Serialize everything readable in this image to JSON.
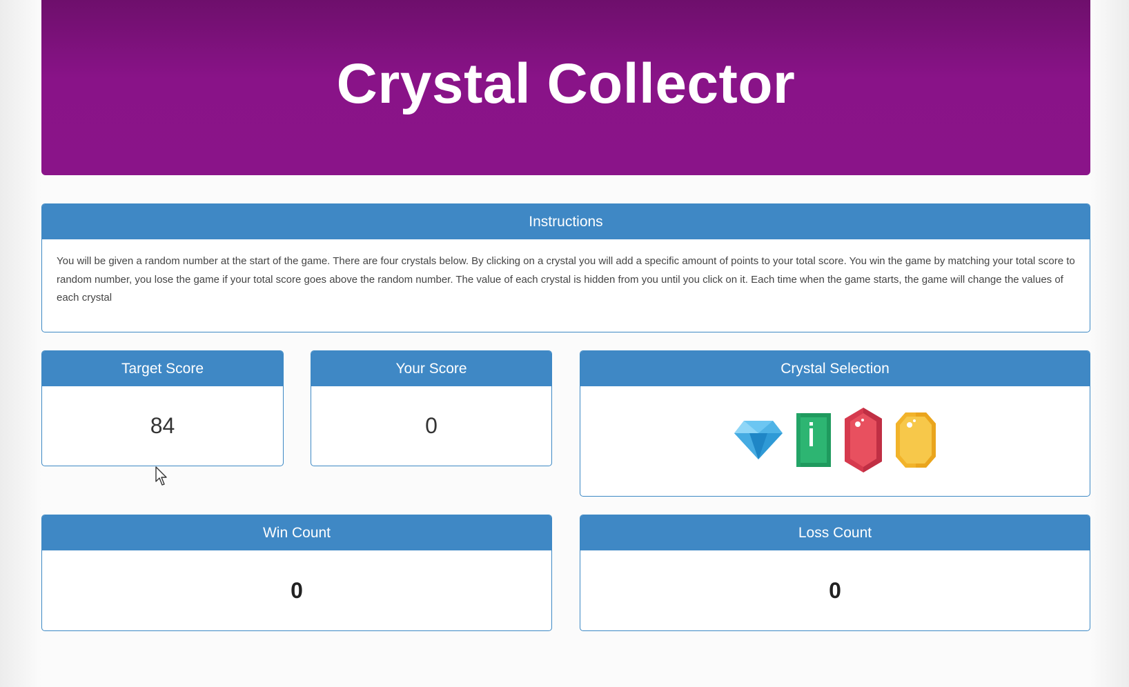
{
  "header": {
    "title": "Crystal Collector",
    "background_color": "#891388"
  },
  "instructions": {
    "heading": "Instructions",
    "text": "You will be given a random number at the start of the game. There are four crystals below. By clicking on a crystal you will add a specific amount of points to your total score. You win the game by matching your total score to random number, you lose the game if your total score goes above the random number. The value of each crystal is hidden from you until you click on it. Each time when the game starts, the game will change the values of each crystal"
  },
  "target_score": {
    "heading": "Target Score",
    "value": "84"
  },
  "your_score": {
    "heading": "Your Score",
    "value": "0"
  },
  "crystal_selection": {
    "heading": "Crystal Selection",
    "crystals": [
      {
        "icon": "blue-diamond-icon",
        "color": "#3fa9e0"
      },
      {
        "icon": "green-emerald-icon",
        "color": "#27a86b"
      },
      {
        "icon": "red-ruby-icon",
        "color": "#e24a5c"
      },
      {
        "icon": "yellow-topaz-icon",
        "color": "#f5c13c"
      }
    ]
  },
  "win_count": {
    "heading": "Win Count",
    "value": "0"
  },
  "loss_count": {
    "heading": "Loss Count",
    "value": "0"
  },
  "panel_color": "#3f88c5"
}
